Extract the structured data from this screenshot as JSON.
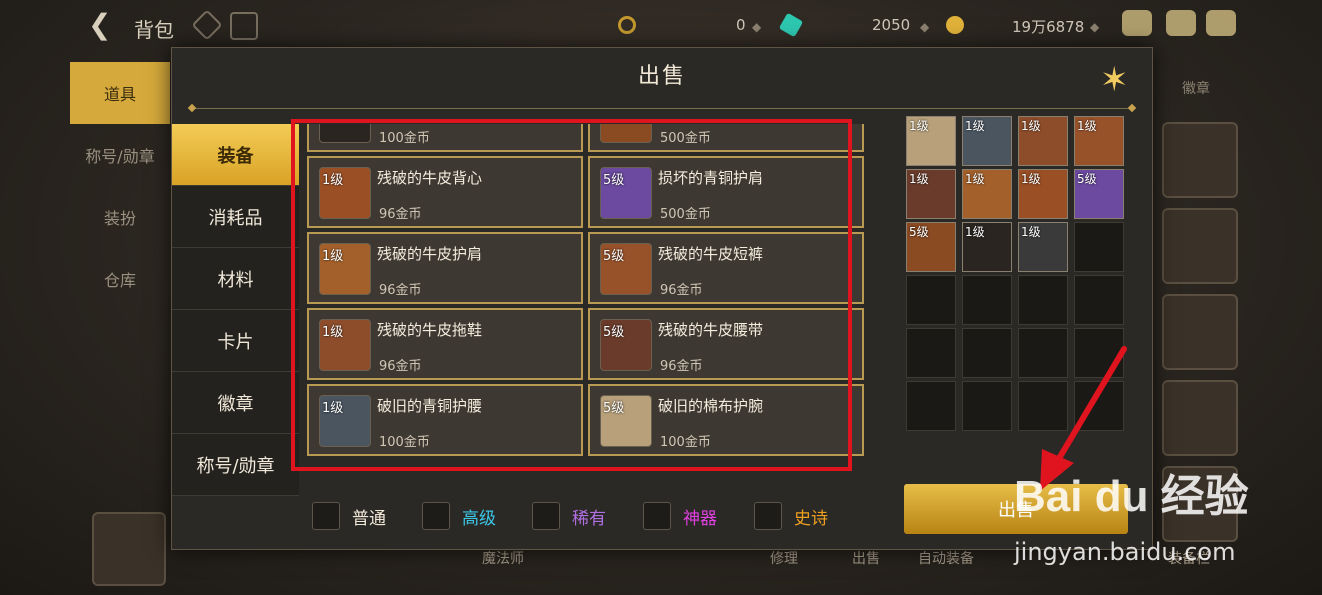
{
  "topbar": {
    "back_icon": "back-arrow-icon",
    "title": "背包",
    "currency1": "0",
    "currency2": "2050",
    "currency3": "19万6878"
  },
  "bg_menu": [
    "道具",
    "称号/勋章",
    "装扮",
    "仓库"
  ],
  "bg_right_title": "徽章",
  "modal": {
    "title": "出售",
    "close_icon": "close-star-icon"
  },
  "tabs": [
    "装备",
    "消耗品",
    "材料",
    "卡片",
    "徽章",
    "称号/勋章"
  ],
  "sell_items": [
    {
      "level": "",
      "name": "",
      "price": "100金币",
      "color": "#2a2520"
    },
    {
      "level": "",
      "name": "",
      "price": "500金币",
      "color": "#8a4a22"
    },
    {
      "level": "1级",
      "name": "残破的牛皮背心",
      "price": "96金币",
      "color": "#9a4f25"
    },
    {
      "level": "5级",
      "name": "损坏的青铜护肩",
      "price": "500金币",
      "color": "#6b4aa0"
    },
    {
      "level": "1级",
      "name": "残破的牛皮护肩",
      "price": "96金币",
      "color": "#a4602a"
    },
    {
      "level": "5级",
      "name": "残破的牛皮短裤",
      "price": "96金币",
      "color": "#98522a"
    },
    {
      "level": "1级",
      "name": "残破的牛皮拖鞋",
      "price": "96金币",
      "color": "#8d4d2a"
    },
    {
      "level": "5级",
      "name": "残破的牛皮腰带",
      "price": "96金币",
      "color": "#6a3b2a"
    },
    {
      "level": "1级",
      "name": "破旧的青铜护腰",
      "price": "100金币",
      "color": "#4a5560"
    },
    {
      "level": "5级",
      "name": "破旧的棉布护腕",
      "price": "100金币",
      "color": "#b7a07a"
    }
  ],
  "filters": [
    {
      "label": "普通",
      "color": "#f0e8d8"
    },
    {
      "label": "高级",
      "color": "#3ac8e8"
    },
    {
      "label": "稀有",
      "color": "#b070e0"
    },
    {
      "label": "神器",
      "color": "#e040e0"
    },
    {
      "label": "史诗",
      "color": "#f0a020"
    }
  ],
  "grid_items": [
    {
      "level": "1级",
      "color": "#b7a07a"
    },
    {
      "level": "1级",
      "color": "#4a5560"
    },
    {
      "level": "1级",
      "color": "#8d4d2a"
    },
    {
      "level": "1级",
      "color": "#98522a"
    },
    {
      "level": "1级",
      "color": "#6a3b2a"
    },
    {
      "level": "1级",
      "color": "#a4602a"
    },
    {
      "level": "1级",
      "color": "#9a4f25"
    },
    {
      "level": "5级",
      "color": "#6b4aa0"
    },
    {
      "level": "5级",
      "color": "#8a4a22"
    },
    {
      "level": "1级",
      "color": "#2a2520"
    },
    {
      "level": "1级",
      "color": "#3a3a3a"
    }
  ],
  "sell_button": "出售",
  "bottom_labels": [
    "魔法师",
    "修理",
    "出售",
    "自动装备",
    "装备栏"
  ],
  "watermark": {
    "brand": "Bai du 经验",
    "url": "jingyan.baidu.com"
  }
}
